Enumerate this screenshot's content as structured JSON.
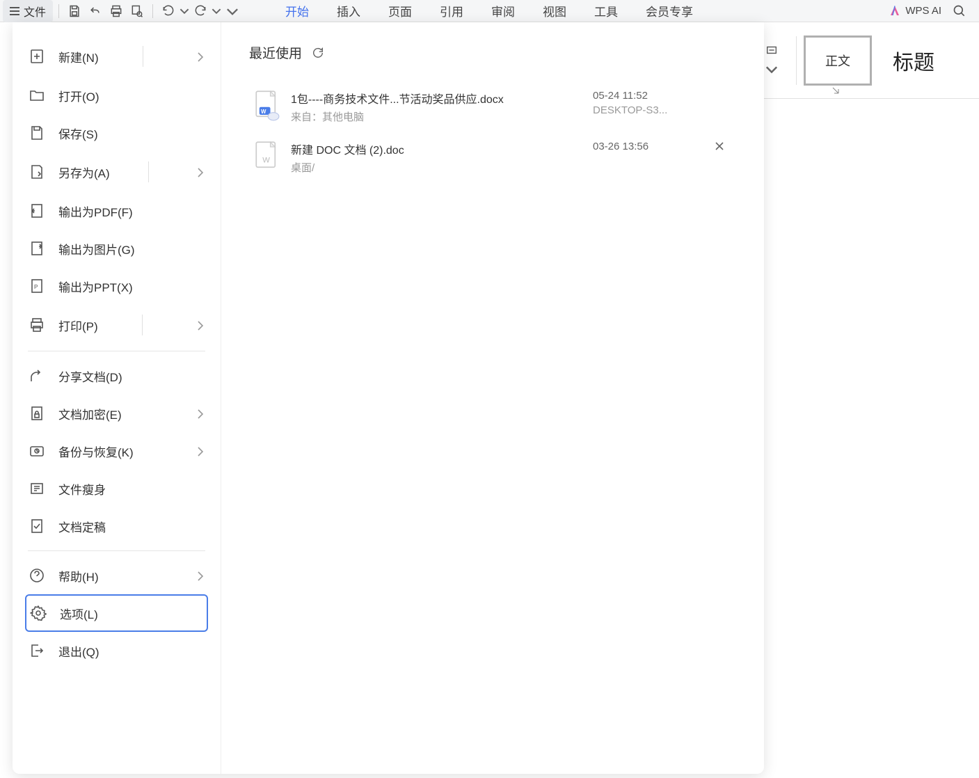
{
  "topbar": {
    "file_btn": "文件"
  },
  "tabs": [
    "开始",
    "插入",
    "页面",
    "引用",
    "审阅",
    "视图",
    "工具",
    "会员专享"
  ],
  "active_tab_index": 0,
  "wps_ai_label": "WPS AI",
  "file_menu": {
    "items": [
      {
        "label": "新建(N)",
        "has_chevron": true
      },
      {
        "label": "打开(O)"
      },
      {
        "label": "保存(S)"
      },
      {
        "label": "另存为(A)",
        "has_chevron": true
      },
      {
        "label": "输出为PDF(F)"
      },
      {
        "label": "输出为图片(G)"
      },
      {
        "label": "输出为PPT(X)"
      },
      {
        "label": "打印(P)",
        "has_chevron": true
      },
      {
        "label": "分享文档(D)"
      },
      {
        "label": "文档加密(E)",
        "has_chevron": true
      },
      {
        "label": "备份与恢复(K)",
        "has_chevron": true
      },
      {
        "label": "文件瘦身"
      },
      {
        "label": "文档定稿"
      },
      {
        "label": "帮助(H)",
        "has_chevron": true
      },
      {
        "label": "选项(L)"
      },
      {
        "label": "退出(Q)"
      }
    ]
  },
  "content": {
    "title": "最近使用",
    "files": [
      {
        "name": "1包----商务技术文件...节活动奖品供应.docx",
        "source": "来自：其他电脑",
        "time": "05-24 11:52",
        "device": "DESKTOP-S3...",
        "icon_type": "docx-cloud"
      },
      {
        "name": "新建 DOC 文档 (2).doc",
        "source": "桌面/",
        "time": "03-26 13:56",
        "device": "",
        "icon_type": "doc"
      }
    ]
  },
  "ribbon": {
    "style_normal": "正文",
    "style_heading": "标题"
  }
}
